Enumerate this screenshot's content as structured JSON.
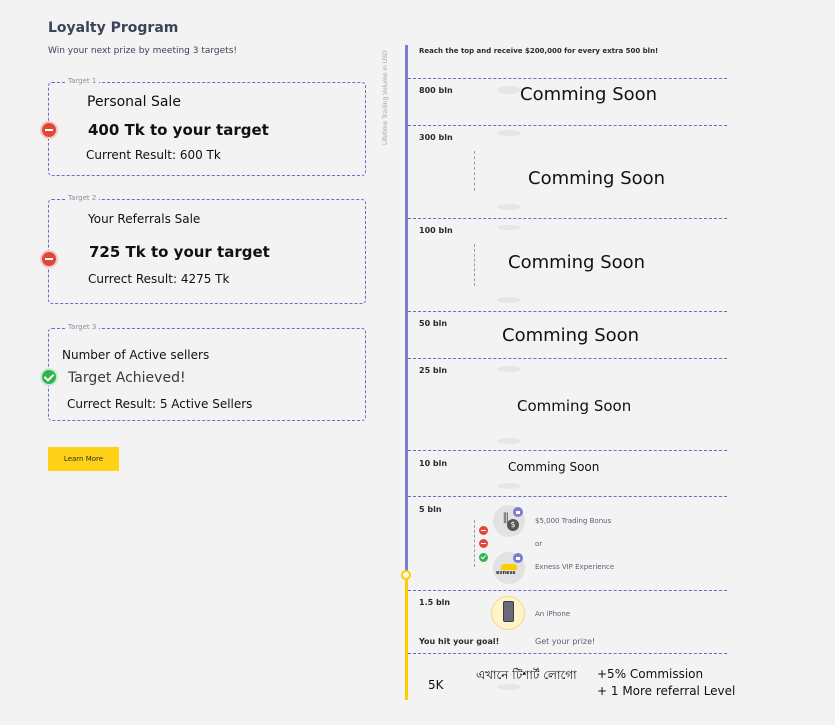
{
  "header": {
    "title": "Loyalty Program",
    "subtitle": "Win your next prize by meeting 3 targets!"
  },
  "targets": [
    {
      "tag": "Target 1",
      "label": "Personal Sale",
      "headline": "400 Tk to your target",
      "result": "Current Result: 600 Tk",
      "status": "incomplete"
    },
    {
      "tag": "Target 2",
      "label": "Your Referrals Sale",
      "headline": "725 Tk to your target",
      "result": "Currect Result: 4275 Tk",
      "status": "incomplete"
    },
    {
      "tag": "Target 3",
      "label": "Number of Active sellers",
      "headline": "Target Achieved!",
      "result": "Currect Result: 5 Active Sellers",
      "status": "achieved"
    }
  ],
  "learn_more_label": "Learn More",
  "timeline": {
    "axis_label": "Lifetime Trading Volume in USD",
    "top_note": "Reach the top and receive $200,000 for every extra 500 bln!",
    "tiers": [
      {
        "label": "800 bln",
        "text": "Comming Soon"
      },
      {
        "label": "300 bln",
        "text": "Comming Soon"
      },
      {
        "label": "100 bln",
        "text": "Comming Soon"
      },
      {
        "label": "50 bln",
        "text": "Comming Soon"
      },
      {
        "label": "25 bln",
        "text": "Comming Soon"
      },
      {
        "label": "10 bln",
        "text": "Comming Soon"
      },
      {
        "label": "5 bln",
        "prize_a": "$5,000 Trading Bonus",
        "or": "or",
        "prize_b": "Exness VIP Experience",
        "brand": "exness"
      },
      {
        "label": "1.5 bln",
        "prize": "An iPhone",
        "goal": "You hit your goal!",
        "cta": "Get your prize!"
      },
      {
        "label": "5K",
        "logo_placeholder": "এখানে টিশার্ট লোগো",
        "benefit_1": "+5% Commission",
        "benefit_2": "+ 1 More referral Level"
      }
    ]
  },
  "colors": {
    "accent": "#7c7cd0",
    "yellow": "#ffcc00",
    "red": "#e0473a",
    "green": "#2fb34f"
  }
}
